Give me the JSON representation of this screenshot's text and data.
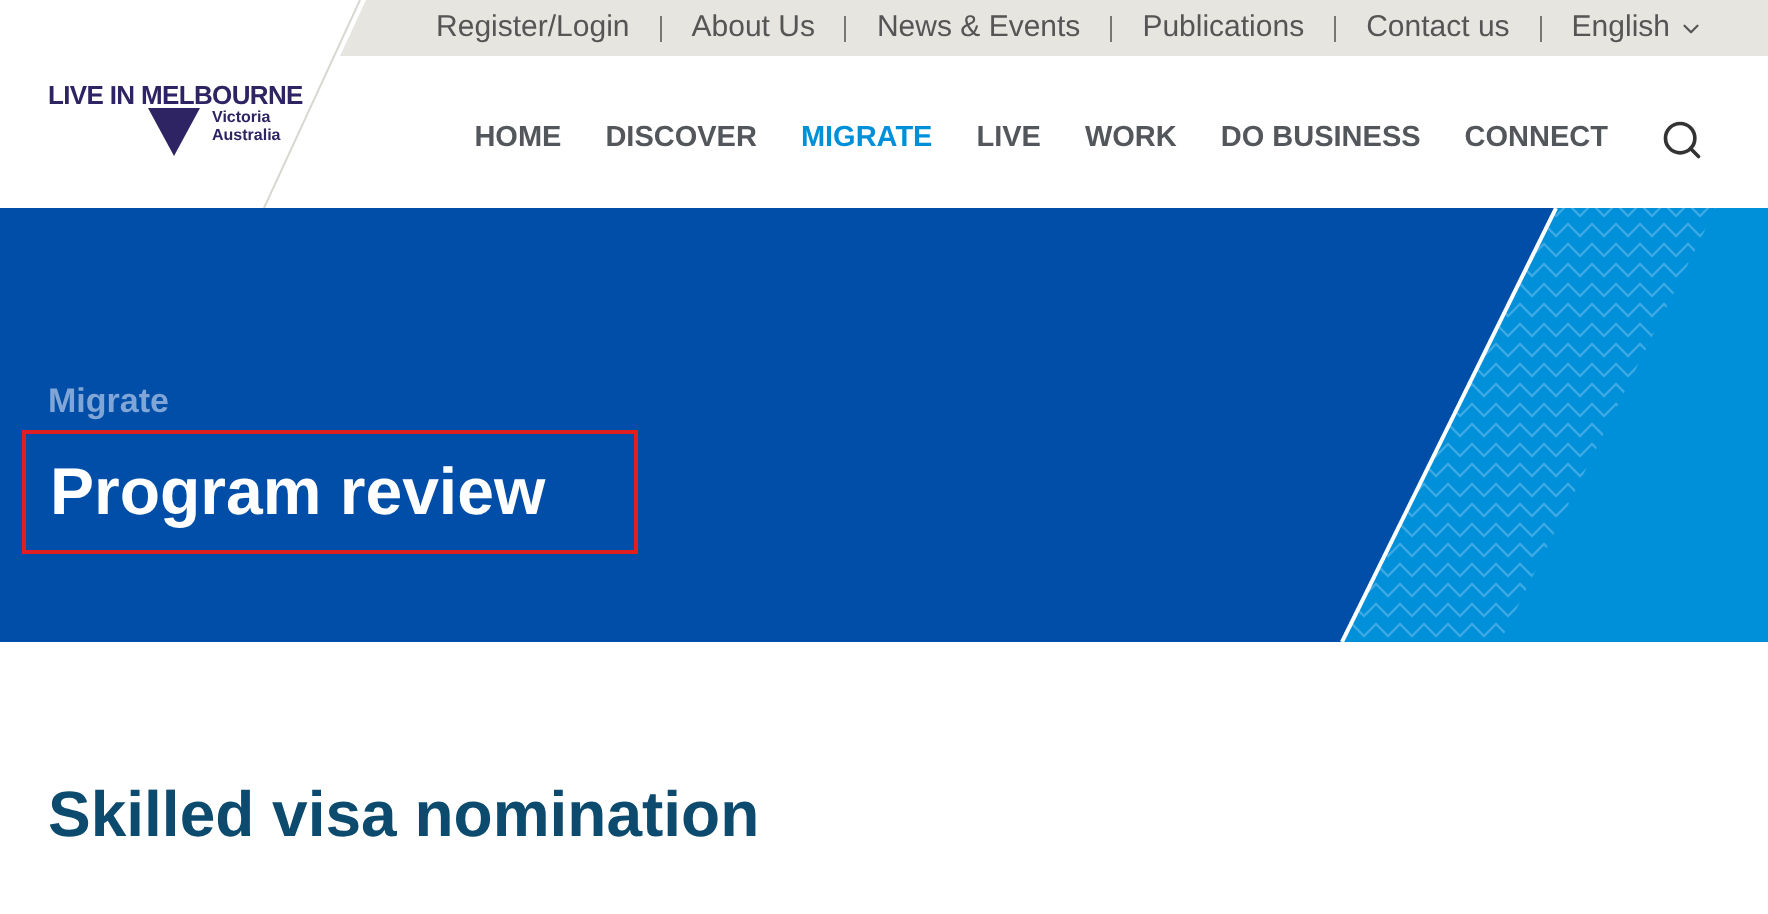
{
  "logo": {
    "name": "LIVE IN MELBOURNE",
    "sub_1": "Victoria",
    "sub_2": "Australia"
  },
  "top_links": [
    "Register/Login",
    "About Us",
    "News & Events",
    "Publications",
    "Contact us"
  ],
  "language": "English",
  "nav": [
    {
      "label": "HOME",
      "selected": false
    },
    {
      "label": "DISCOVER",
      "selected": false
    },
    {
      "label": "MIGRATE",
      "selected": true
    },
    {
      "label": "LIVE",
      "selected": false
    },
    {
      "label": "WORK",
      "selected": false
    },
    {
      "label": "DO BUSINESS",
      "selected": false
    },
    {
      "label": "CONNECT",
      "selected": false
    }
  ],
  "hero": {
    "breadcrumb": "Migrate",
    "title": "Program review",
    "title_highlighted": true
  },
  "section_heading": "Skilled visa nomination"
}
